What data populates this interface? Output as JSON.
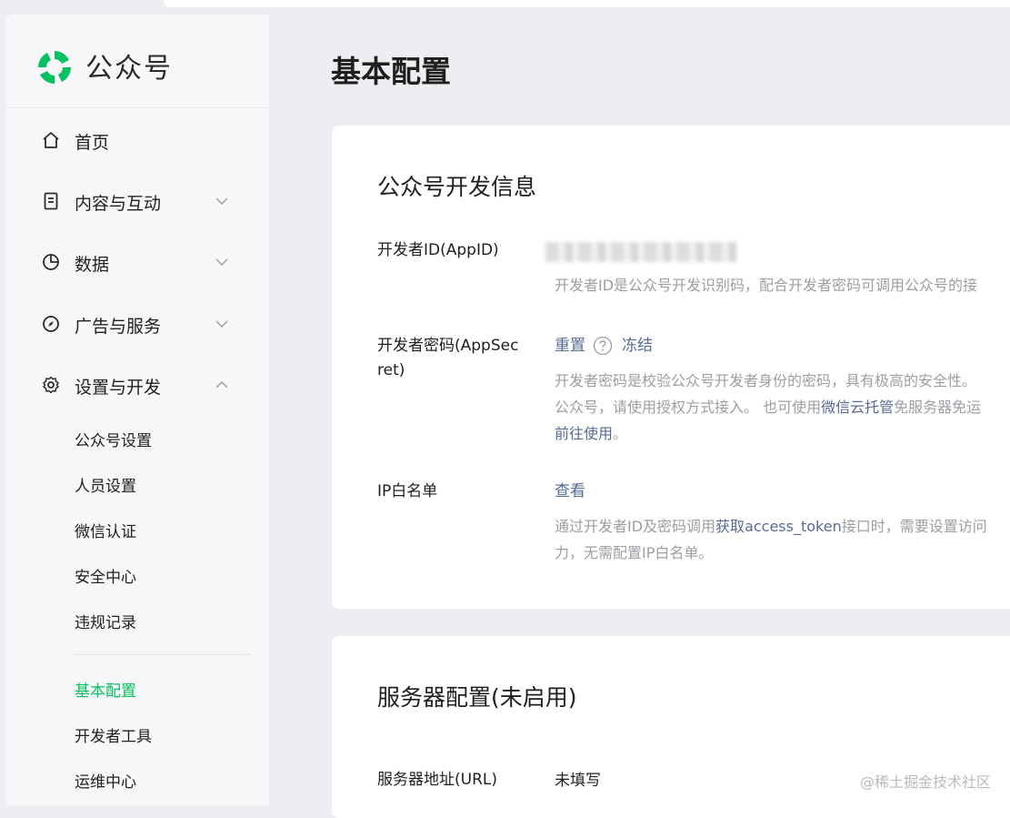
{
  "app": {
    "name": "公众号"
  },
  "page": {
    "title": "基本配置"
  },
  "sidebar": {
    "items": [
      {
        "label": "首页",
        "icon": "home-icon"
      },
      {
        "label": "内容与互动",
        "icon": "document-icon"
      },
      {
        "label": "数据",
        "icon": "pie-chart-icon"
      },
      {
        "label": "广告与服务",
        "icon": "compass-icon"
      },
      {
        "label": "设置与开发",
        "icon": "gear-icon"
      }
    ],
    "sub_items": [
      "公众号设置",
      "人员设置",
      "微信认证",
      "安全中心",
      "违规记录"
    ],
    "sub_items_2": [
      "基本配置",
      "开发者工具",
      "运维中心"
    ],
    "active": "基本配置"
  },
  "dev_info": {
    "title": "公众号开发信息",
    "appid": {
      "label": "开发者ID(AppID)",
      "desc": "开发者ID是公众号开发识别码，配合开发者密码可调用公众号的接"
    },
    "secret": {
      "label_line1": "开发者密码(AppSec",
      "label_line2": "ret)",
      "reset": "重置",
      "freeze": "冻结",
      "desc_line1": "开发者密码是校验公众号开发者身份的密码，具有极高的安全性。",
      "desc_line2_a": "公众号，请使用授权方式接入。 也可使用",
      "desc_line2_link": "微信云托管",
      "desc_line2_b": "免服务器免运",
      "desc_line3_link": "前往使用",
      "desc_line3_b": "。"
    },
    "ip": {
      "label": "IP白名单",
      "view": "查看",
      "desc_line1_a": "通过开发者ID及密码调用",
      "desc_line1_link": "获取access_token",
      "desc_line1_b": "接口时，需要设置访问",
      "desc_line2": "力，无需配置IP白名单。"
    }
  },
  "server": {
    "title": "服务器配置(未启用)",
    "url_label": "服务器地址(URL)",
    "url_value": "未填写"
  },
  "watermark": "@稀土掘金技术社区",
  "colors": {
    "accent": "#07c160",
    "link": "#576b95",
    "muted": "#9b9ea3"
  }
}
